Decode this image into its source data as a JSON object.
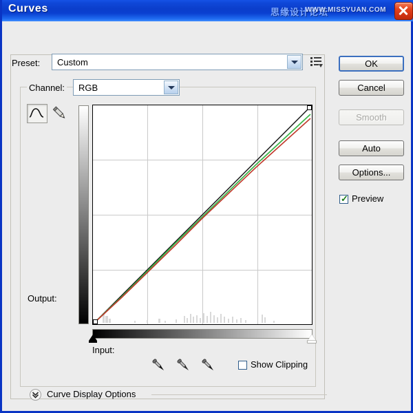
{
  "window": {
    "title": "Curves",
    "watermark_cn": "思缘设计论坛",
    "watermark_url": "WWW.MISSYUAN.COM",
    "close_icon": "close-x-icon",
    "titlebar_color": "#0b3ecb",
    "close_button_color": "#e4411c",
    "background_color": "#ececec",
    "border_color": "#0a34c4"
  },
  "preset": {
    "label": "Preset:",
    "value": "Custom",
    "placeholder": "Custom",
    "dropdown_icon": "chevron-down-icon",
    "menu_icon": "preset-menu-icon"
  },
  "channel": {
    "label": "Channel:",
    "value": "RGB",
    "dropdown_icon": "chevron-down-icon"
  },
  "tools": {
    "curve_tool": "curve-tool-icon",
    "pencil_tool": "pencil-tool-icon",
    "curve_tool_selected": true,
    "pencil_tool_selected": false
  },
  "graph": {
    "output_label": "Output:",
    "input_label": "Input:",
    "grid_divisions": 4,
    "black_marker": "black-point-marker",
    "white_marker": "white-point-marker"
  },
  "chart_data": {
    "type": "line",
    "title": "Curves",
    "xlabel": "Input",
    "ylabel": "Output",
    "xlim": [
      0,
      255
    ],
    "ylim": [
      0,
      255
    ],
    "grid": true,
    "legend": "none",
    "series": [
      {
        "name": "Baseline (diagonal)",
        "color": "#000000",
        "x": [
          0,
          64,
          128,
          192,
          255
        ],
        "values": [
          0,
          64,
          128,
          192,
          255
        ]
      },
      {
        "name": "Green channel",
        "color": "#3bb54a",
        "x": [
          0,
          32,
          64,
          96,
          128,
          160,
          192,
          224,
          255
        ],
        "values": [
          0,
          30,
          61,
          92,
          124,
          154,
          185,
          215,
          244
        ]
      },
      {
        "name": "Red channel",
        "color": "#c0392b",
        "x": [
          0,
          32,
          64,
          96,
          128,
          160,
          192,
          224,
          255
        ],
        "values": [
          0,
          29,
          59,
          89,
          121,
          150,
          180,
          209,
          238
        ]
      }
    ],
    "control_points": [
      {
        "input": 0,
        "output": 0
      },
      {
        "input": 255,
        "output": 255
      }
    ],
    "histogram_visible": true
  },
  "eyedroppers": {
    "black_point": "eyedropper-black-icon",
    "gray_point": "eyedropper-gray-icon",
    "white_point": "eyedropper-white-icon"
  },
  "show_clipping": {
    "label": "Show Clipping",
    "checked": false
  },
  "curve_display_options": {
    "label": "Curve Display Options",
    "expanded": false,
    "toggle_icon": "chevron-double-down-icon"
  },
  "buttons": {
    "ok": "OK",
    "cancel": "Cancel",
    "smooth": "Smooth",
    "auto": "Auto",
    "options": "Options..."
  },
  "preview": {
    "label": "Preview",
    "checked": true,
    "check_color": "#1a7b1a"
  }
}
